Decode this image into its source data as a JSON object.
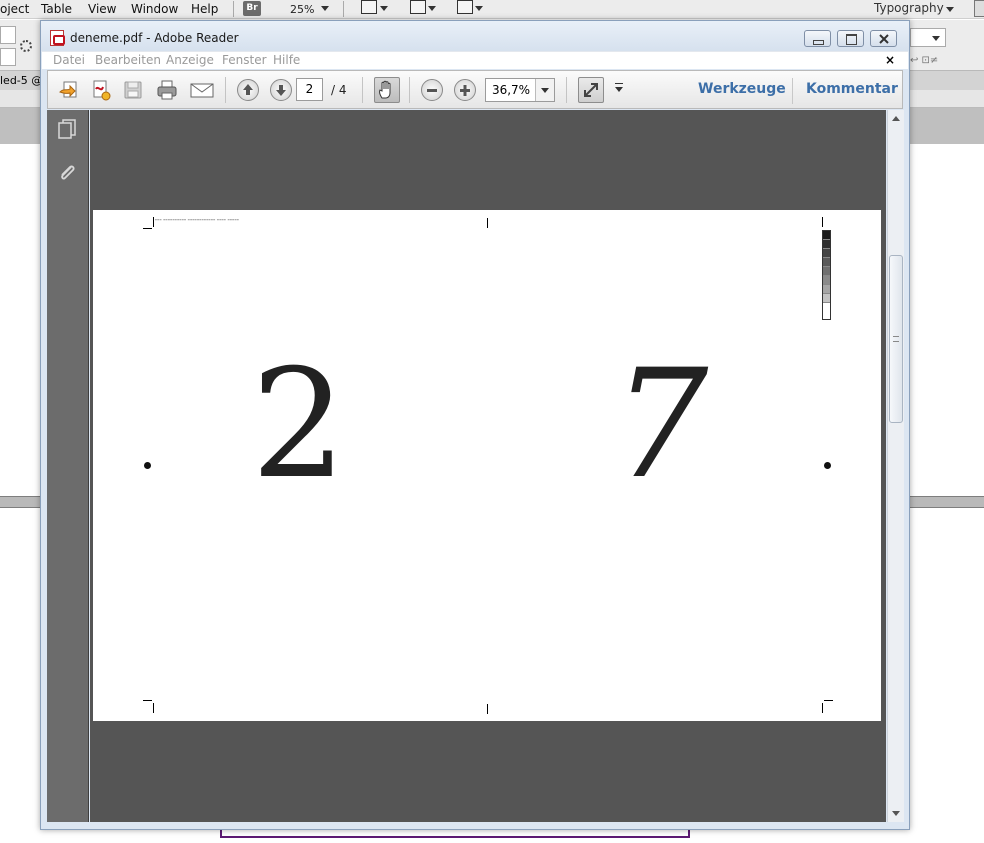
{
  "background_app": {
    "menu": [
      "oject",
      "Table",
      "View",
      "Window",
      "Help"
    ],
    "bridge_label": "Br",
    "zoom": "25%",
    "workspace": "Typography",
    "doc_tab": "led-5 @"
  },
  "reader": {
    "title": "deneme.pdf - Adobe Reader",
    "menu": [
      "Datei",
      "Bearbeiten",
      "Anzeige",
      "Fenster",
      "Hilfe"
    ],
    "doc_close": "×",
    "toolbar": {
      "page_current": "2",
      "page_total": "/ 4",
      "zoom": "36,7%",
      "tools_label": "Werkzeuge",
      "comment_label": "Kommentar"
    },
    "page": {
      "left_digit": "2",
      "right_digit": "7"
    }
  },
  "colors": {
    "document_bg": "#555555",
    "nav_pane": "#6c6c6c",
    "link_blue": "#3d6fa8",
    "window_frame": "#dce6f2"
  },
  "icons": {
    "nav": [
      "pages-icon",
      "attachment-icon"
    ],
    "toolbar": [
      "create-pdf-icon",
      "edit-pdf-icon",
      "save-icon",
      "print-icon",
      "email-icon",
      "page-up-icon",
      "page-down-icon",
      "hand-tool-icon",
      "zoom-out-icon",
      "zoom-in-icon",
      "fit-page-icon"
    ]
  }
}
